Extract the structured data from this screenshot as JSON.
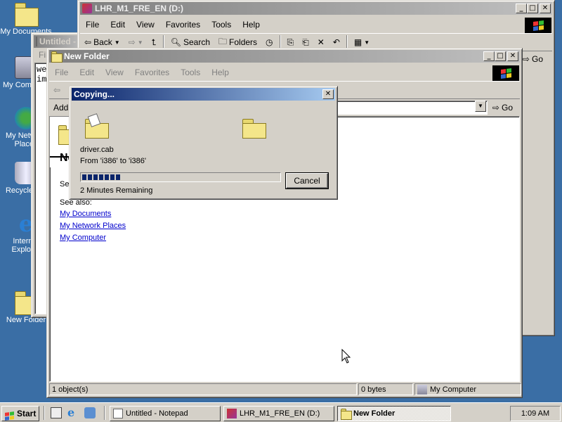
{
  "desktop": {
    "icons": [
      {
        "label": "My Documents",
        "icon": "my-documents-icon"
      },
      {
        "label": "My Computer",
        "icon": "my-computer-icon"
      },
      {
        "label": "My Network Places",
        "icon": "network-places-icon"
      },
      {
        "label": "Recycle Bin",
        "icon": "recycle-bin-icon"
      },
      {
        "label": "Internet Explorer",
        "icon": "internet-explorer-icon"
      },
      {
        "label": "New Folder",
        "icon": "folder-icon"
      }
    ]
  },
  "window_back": {
    "title": "LHR_M1_FRE_EN (D:)",
    "menu": [
      "File",
      "Edit",
      "View",
      "Favorites",
      "Tools",
      "Help"
    ],
    "toolbar": {
      "back": "Back",
      "search": "Search",
      "folders": "Folders",
      "go": "Go"
    }
  },
  "notepad": {
    "title": "Untitled - Notepad",
    "menu_file": "File",
    "text_line1": "we",
    "text_line2": "im"
  },
  "window_front": {
    "title": "New Folder",
    "menu": [
      "File",
      "Edit",
      "View",
      "Favorites",
      "Tools",
      "Help"
    ],
    "address_label": "Addre",
    "go": "Go",
    "left_pane": {
      "title_partial": "Ne",
      "select_partial": "Sele",
      "see_also": "See also:",
      "links": [
        "My Documents",
        "My Network Places",
        "My Computer"
      ]
    },
    "status": {
      "objects": "1 object(s)",
      "size": "0 bytes",
      "zone": "My Computer"
    }
  },
  "copy_dialog": {
    "title": "Copying...",
    "filename": "driver.cab",
    "from_to": "From 'i386' to 'i386'",
    "remaining": "2 Minutes Remaining",
    "cancel": "Cancel",
    "progress_fraction": 0.2
  },
  "taskbar": {
    "start": "Start",
    "tasks": [
      {
        "label": "Untitled - Notepad",
        "pressed": false
      },
      {
        "label": "LHR_M1_FRE_EN (D:)",
        "pressed": false
      },
      {
        "label": "New Folder",
        "pressed": true
      }
    ],
    "clock": "1:09 AM"
  },
  "colors": {
    "desktop": "#3a6ea5",
    "active_title": "#0a246a",
    "progress": "#0a246a"
  }
}
